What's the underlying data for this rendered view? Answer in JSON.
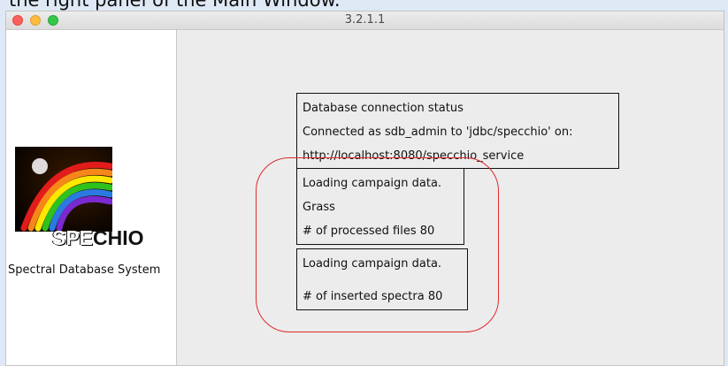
{
  "caption": "the right panel of the Main Window.",
  "window": {
    "title": "3.2.1.1",
    "traffic_lights": {
      "close": "#fc605c",
      "minimize": "#fdbc40",
      "maximize": "#34c84a"
    }
  },
  "sidebar": {
    "logo_text_prefix": "SPE",
    "logo_text_suffix": "CHIO",
    "subtitle": "Spectral Database System"
  },
  "connection_status": {
    "heading": "Database connection status",
    "connected_line": "Connected as sdb_admin to 'jdbc/specchio' on:",
    "url": "http://localhost:8080/specchio_service"
  },
  "campaign_progress": {
    "heading": "Loading campaign data.",
    "campaign_name": "Grass",
    "processed_label": "# of processed files  80"
  },
  "spectra_progress": {
    "heading": "Loading campaign data.",
    "inserted_label": "# of inserted spectra  80"
  },
  "colors": {
    "highlight": "#e0292b",
    "page_background": "#dfe8f5"
  }
}
